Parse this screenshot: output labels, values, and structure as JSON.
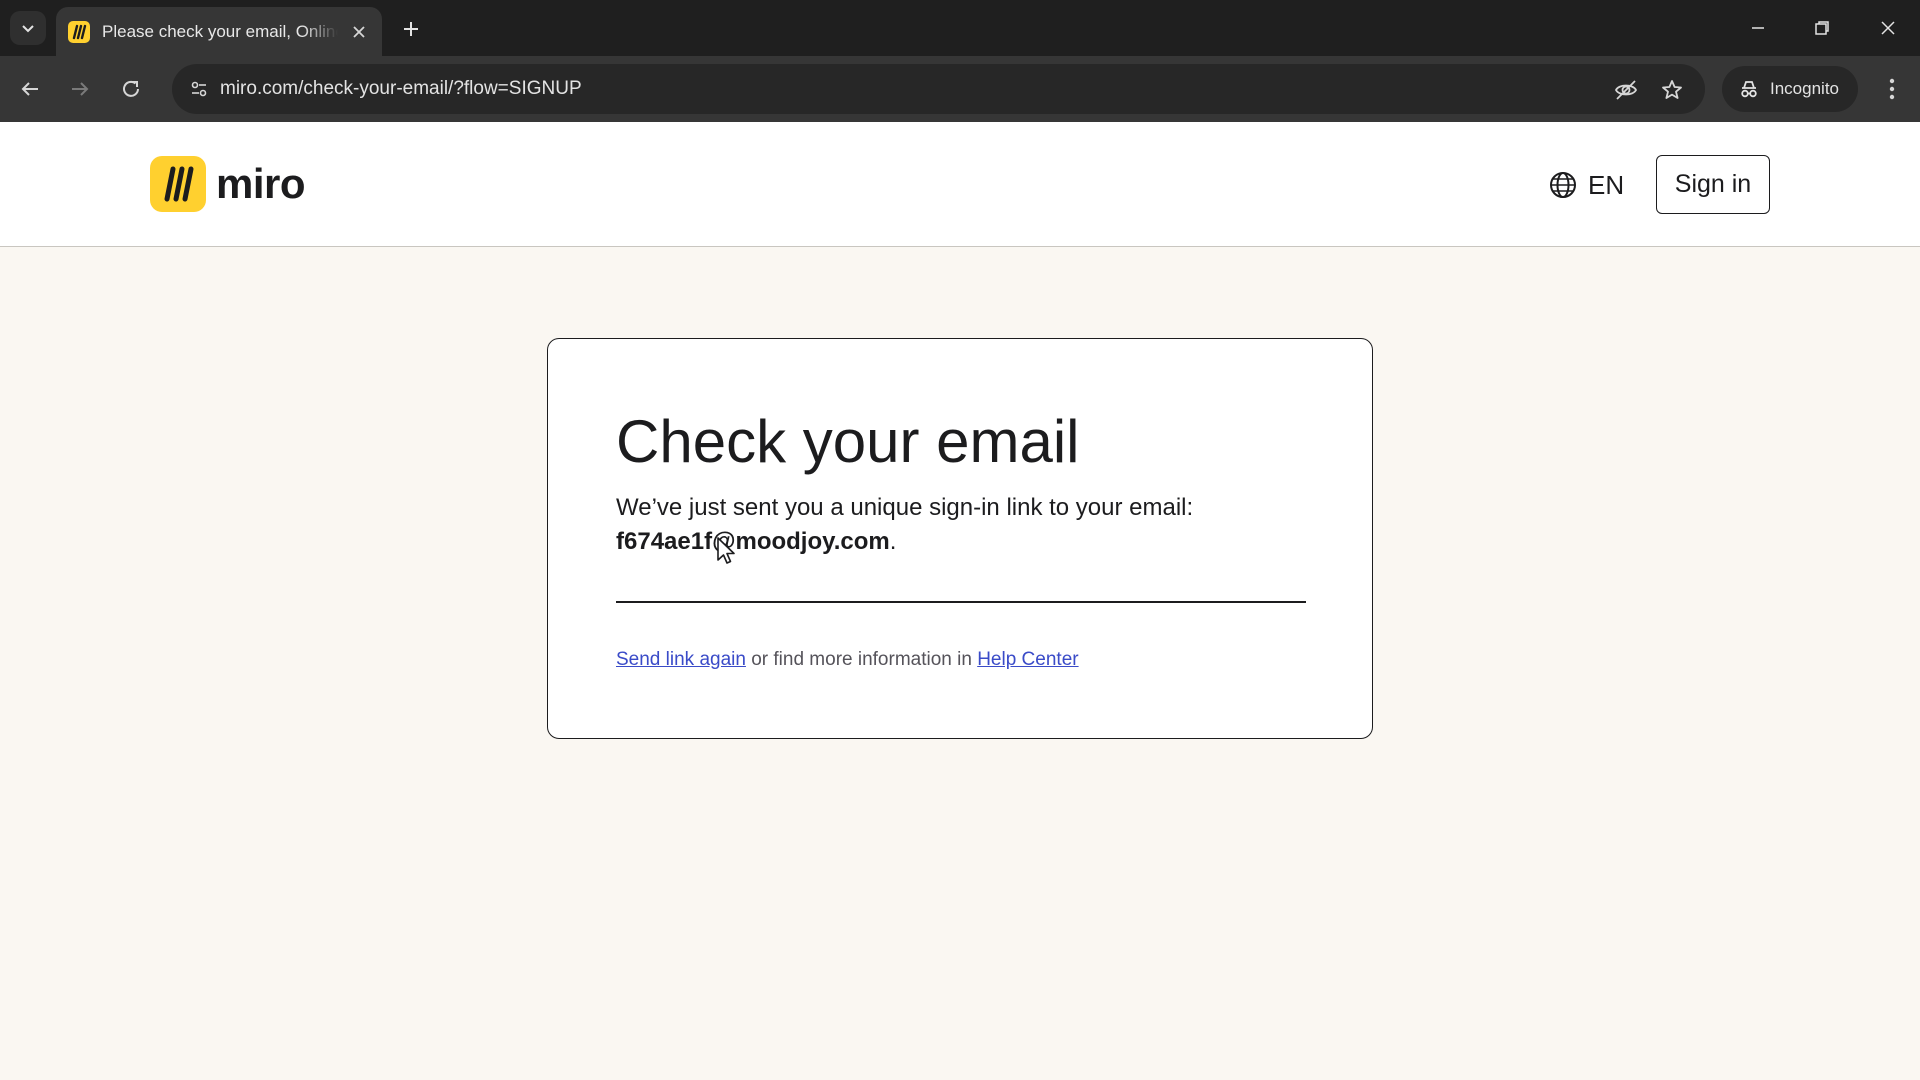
{
  "browser": {
    "tab_title": "Please check your email, Online",
    "url": "miro.com/check-your-email/?flow=SIGNUP",
    "incognito_label": "Incognito"
  },
  "header": {
    "logo_text": "miro",
    "language": "EN",
    "signin_label": "Sign in"
  },
  "card": {
    "title": "Check your email",
    "description": "We’ve just sent you a unique sign-in link to your email:",
    "email": "f674ae1f@moodjoy.com",
    "email_suffix": ".",
    "resend_link": "Send link again",
    "footer_middle": " or find more information in ",
    "help_link": "Help Center"
  },
  "colors": {
    "brand_yellow": "#ffd02f",
    "link_blue": "#3a4bc8",
    "page_background": "#faf7f2"
  },
  "icons": [
    "tab-search-icon",
    "miro-favicon-icon",
    "close-icon",
    "plus-icon",
    "minimize-icon",
    "restore-icon",
    "back-arrow-icon",
    "forward-arrow-icon",
    "reload-icon",
    "site-info-icon",
    "eye-off-icon",
    "star-icon",
    "incognito-icon",
    "more-vert-icon",
    "globe-icon",
    "miro-logo-icon",
    "cursor-icon"
  ]
}
